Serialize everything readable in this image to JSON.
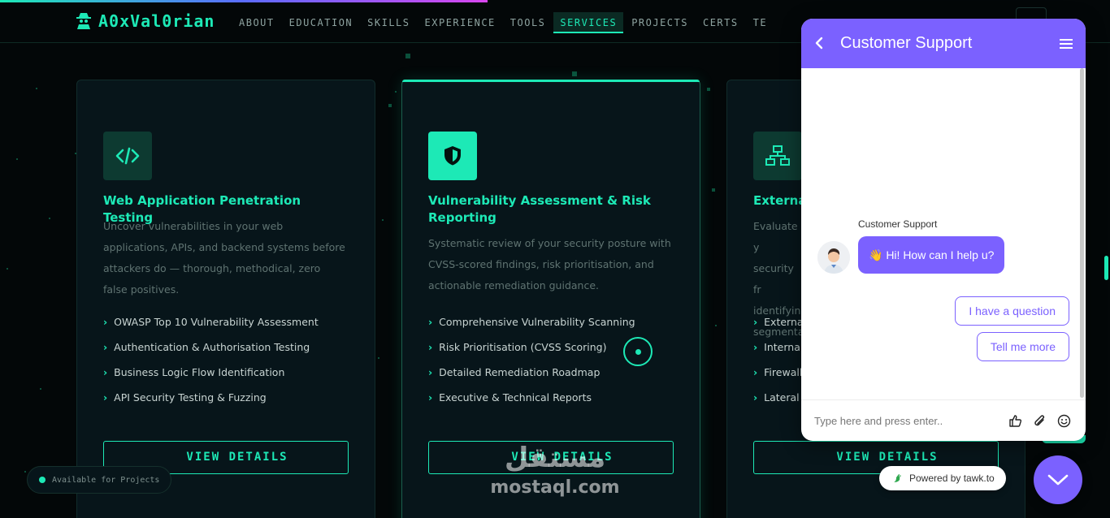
{
  "brand": {
    "logo_text": "A0xVal0rian",
    "accent": "#1de9b6"
  },
  "nav": {
    "items": [
      {
        "label": "ABOUT",
        "active": false
      },
      {
        "label": "EDUCATION",
        "active": false
      },
      {
        "label": "SKILLS",
        "active": false
      },
      {
        "label": "EXPERIENCE",
        "active": false
      },
      {
        "label": "TOOLS",
        "active": false
      },
      {
        "label": "SERVICES",
        "active": true
      },
      {
        "label": "PROJECTS",
        "active": false
      },
      {
        "label": "CERTS",
        "active": false
      },
      {
        "label": "TE",
        "active": false
      }
    ]
  },
  "services": [
    {
      "icon": "code-icon",
      "title": "Web Application Penetration Testing",
      "description": "Uncover vulnerabilities in your web applications, APIs, and backend systems before attackers do — thorough, methodical, zero false positives.",
      "features": [
        "OWASP Top 10 Vulnerability Assessment",
        "Authentication & Authorisation Testing",
        "Business Logic Flow Identification",
        "API Security Testing & Fuzzing"
      ],
      "button": "VIEW DETAILS"
    },
    {
      "icon": "shield-icon",
      "title": "Vulnerability Assessment & Risk Reporting",
      "description": "Systematic review of your security posture with CVSS-scored findings, risk prioritisation, and actionable remediation guidance.",
      "features": [
        "Comprehensive Vulnerability Scanning",
        "Risk Prioritisation (CVSS Scoring)",
        "Detailed Remediation Roadmap",
        "Executive & Technical Reports"
      ],
      "button": "VIEW DETAILS"
    },
    {
      "icon": "network-icon",
      "title": "External",
      "description": "Evaluate y security fr identifying segmentat",
      "features": [
        "External",
        "Internal",
        "Firewall",
        "Lateral"
      ],
      "button": "VIEW DETAILS"
    }
  ],
  "availability": {
    "label": "Available for Projects"
  },
  "watermark": {
    "arabic": "مستقل",
    "latin": "mostaql.com"
  },
  "chat": {
    "title": "Customer Support",
    "agent_name": "Customer Support",
    "greeting": "👋 Hi! How can I help u?",
    "quick_replies": [
      "I have a question",
      "Tell me more"
    ],
    "input_placeholder": "Type here and press enter..",
    "powered_by": "Powered by tawk.to",
    "color": "#7b61ff"
  }
}
